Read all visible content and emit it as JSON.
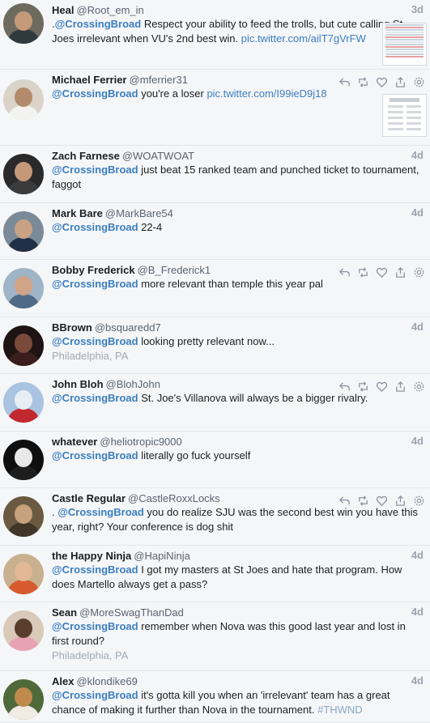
{
  "tweets": [
    {
      "name": "Heal",
      "handle": "@Root_em_in",
      "time": "3d",
      "segments": [
        {
          "t": "text",
          "v": "."
        },
        {
          "t": "mention",
          "v": "@CrossingBroad"
        },
        {
          "t": "text",
          "v": " Respect your ability to feed the trolls, but cute calling St Joes irrelevant when VU's 2nd best win. "
        },
        {
          "t": "link",
          "v": "pic.twitter.com/ailT7gVrFW"
        }
      ],
      "avatar": {
        "bg": "#6e6a5e",
        "head": "#c49a7a",
        "body": "#2f3a3f"
      },
      "thumb": "table"
    },
    {
      "name": "Michael Ferrier",
      "handle": "@mferrier31",
      "time": "",
      "segments": [
        {
          "t": "mention",
          "v": "@CrossingBroad"
        },
        {
          "t": "text",
          "v": " you're a loser "
        },
        {
          "t": "link",
          "v": "pic.twitter.com/I99ieD9j18"
        }
      ],
      "avatar": {
        "bg": "#d9d3c8",
        "head": "#b48a6c",
        "body": "#f2f2f0"
      },
      "actions": true,
      "thumb": "form"
    },
    {
      "name": "Zach Farnese",
      "handle": "@WOATWOAT",
      "time": "4d",
      "segments": [
        {
          "t": "mention",
          "v": "@CrossingBroad"
        },
        {
          "t": "text",
          "v": " just beat 15 ranked team and punched ticket to tournament, faggot"
        }
      ],
      "avatar": {
        "bg": "#2a2a2a",
        "head": "#c5987a",
        "body": "#3b3b3b"
      }
    },
    {
      "name": "Mark Bare",
      "handle": "@MarkBare54",
      "time": "4d",
      "segments": [
        {
          "t": "mention",
          "v": "@CrossingBroad"
        },
        {
          "t": "text",
          "v": " 22-4"
        }
      ],
      "avatar": {
        "bg": "#7a8a98",
        "head": "#c9a184",
        "body": "#223047"
      }
    },
    {
      "name": "Bobby Frederick",
      "handle": "@B_Frederick1",
      "time": "",
      "segments": [
        {
          "t": "mention",
          "v": "@CrossingBroad"
        },
        {
          "t": "text",
          "v": " more relevant than temple this year pal"
        }
      ],
      "avatar": {
        "bg": "#9fb4c6",
        "head": "#d1a487",
        "body": "#4e6a86"
      },
      "actions": true
    },
    {
      "name": "BBrown",
      "handle": "@bsquaredd7",
      "time": "4d",
      "segments": [
        {
          "t": "mention",
          "v": "@CrossingBroad"
        },
        {
          "t": "text",
          "v": " looking pretty relevant now..."
        }
      ],
      "location": "Philadelphia, PA",
      "avatar": {
        "bg": "#1e1414",
        "head": "#7a4a3a",
        "body": "#3a1e1e"
      }
    },
    {
      "name": "John Bloh",
      "handle": "@BlohJohn",
      "time": "",
      "segments": [
        {
          "t": "mention",
          "v": "@CrossingBroad"
        },
        {
          "t": "text",
          "v": " St. Joe's Villanova will always be a bigger rivalry."
        }
      ],
      "avatar": {
        "bg": "#a9c3e0",
        "head": "#e9eef5",
        "body": "#c2292e"
      },
      "actions": true
    },
    {
      "name": "whatever",
      "handle": "@heliotropic9000",
      "time": "4d",
      "segments": [
        {
          "t": "mention",
          "v": "@CrossingBroad"
        },
        {
          "t": "text",
          "v": " literally go fuck yourself"
        }
      ],
      "avatar": {
        "bg": "#0f0f0f",
        "head": "#e8e8e8",
        "body": "#1e1e1e"
      }
    },
    {
      "name": "Castle Regular",
      "handle": "@CastleRoxxLocks",
      "time": "",
      "segments": [
        {
          "t": "text",
          "v": ". "
        },
        {
          "t": "mention",
          "v": "@CrossingBroad"
        },
        {
          "t": "text",
          "v": " you do realize SJU was the second best win you have this year, right?  Your conference is dog shit"
        }
      ],
      "avatar": {
        "bg": "#6b5a42",
        "head": "#c7a27c",
        "body": "#3f3529"
      },
      "actions": true
    },
    {
      "name": "the Happy Ninja",
      "handle": "@HapiNinja",
      "time": "4d",
      "segments": [
        {
          "t": "mention",
          "v": "@CrossingBroad"
        },
        {
          "t": "text",
          "v": " I got my masters at St Joes and hate that program. How does Martello always get a pass?"
        }
      ],
      "avatar": {
        "bg": "#c9b08e",
        "head": "#e2b896",
        "body": "#d65a2e"
      }
    },
    {
      "name": "Sean",
      "handle": "@MoreSwagThanDad",
      "time": "4d",
      "segments": [
        {
          "t": "mention",
          "v": "@CrossingBroad"
        },
        {
          "t": "text",
          "v": " remember when Nova was this good last year and lost in first round?"
        }
      ],
      "location": "Philadelphia, PA",
      "avatar": {
        "bg": "#d8c9b8",
        "head": "#5b3d2e",
        "body": "#e7a3b3"
      }
    },
    {
      "name": "Alex",
      "handle": "@klondike69",
      "time": "4d",
      "segments": [
        {
          "t": "mention",
          "v": "@CrossingBroad"
        },
        {
          "t": "text",
          "v": " it's gotta kill you when an 'irrelevant' team has a great chance of making it further than Nova in the tournament. "
        },
        {
          "t": "hashtag",
          "v": "#THWND"
        }
      ],
      "avatar": {
        "bg": "#4f6a3a",
        "head": "#c08a4c",
        "body": "#f0ebe3"
      }
    }
  ]
}
